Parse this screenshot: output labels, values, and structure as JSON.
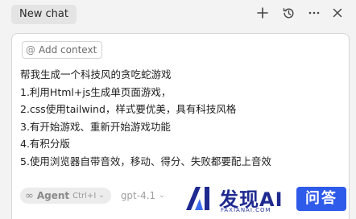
{
  "header": {
    "tab_label": "New chat",
    "icons": {
      "new": "plus-icon",
      "history": "history-icon",
      "more": "ellipsis-icon",
      "close": "close-icon"
    }
  },
  "composer": {
    "context_chip": "Add context",
    "context_icon": "at-icon",
    "prompt_lines": [
      "帮我生成一个科技风的贪吃蛇游戏",
      "1.利用Html+js生成单页面游戏，",
      "2.css使用tailwind，样式要优美，具有科技风格",
      "3.有开始游戏、重新开始游戏功能",
      "4.有积分版",
      "5.使用浏览器自带音效，移动、得分、失败都要配上音效"
    ],
    "mode": {
      "icon": "infinity-icon",
      "label": "Agent",
      "shortcut": "Ctrl+I"
    },
    "model": "gpt-4.1"
  },
  "watermark": {
    "brand": "发现AI",
    "sub": "FAXIANAI.COM",
    "badge": "问答"
  }
}
